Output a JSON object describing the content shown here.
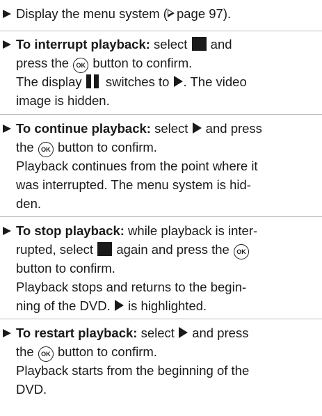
{
  "steps": [
    {
      "text_1": "Display the menu system (",
      "text_2": "page 97).",
      "page_ref": "97"
    },
    {
      "label": "To interrupt playback:",
      "l1_text_1": " select ",
      "l1_text_2": " and",
      "l2_text_1": "press the ",
      "l2_text_2": " button to confirm.",
      "l3_text_1": "The display ",
      "l3_text_2": " switches to ",
      "l3_text_3": ". The video",
      "l4_text": "image is hidden."
    },
    {
      "label": "To continue playback:",
      "l1_text_1": " select ",
      "l1_text_2": " and press",
      "l2_text_1": "the ",
      "l2_text_2": " button to confirm.",
      "l3_text": "Playback continues from the point where it",
      "l4_text": "was interrupted. The menu system is hid-",
      "l5_text": "den."
    },
    {
      "label": "To stop playback:",
      "l1_text": " while playback is inter-",
      "l2_text_1": "rupted, select ",
      "l2_text_2": " again and press the ",
      "l3_text": "button to confirm.",
      "l4_text": "Playback stops and returns to the begin-",
      "l5_text_1": "ning of the DVD. ",
      "l5_text_2": " is highlighted."
    },
    {
      "label": "To restart playback:",
      "l1_text_1": " select ",
      "l1_text_2": " and press",
      "l2_text_1": "the ",
      "l2_text_2": " button to confirm.",
      "l3_text": "Playback starts from the beginning of the",
      "l4_text": "DVD."
    }
  ],
  "icons": {
    "ok_label": "OK",
    "bullet": "arrow-right-icon",
    "stop": "stop-icon",
    "pause": "pause-icon",
    "play": "play-icon",
    "ok": "ok-button-icon",
    "page_ref": "page-reference-icon"
  }
}
